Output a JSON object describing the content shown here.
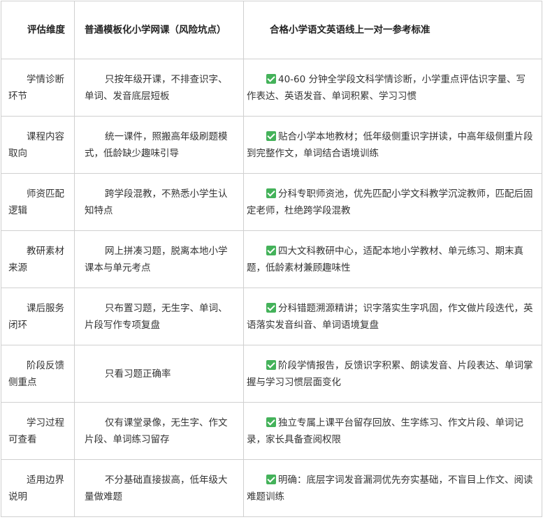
{
  "headers": {
    "dimension": "评估维度",
    "risk": "普通模板化小学网课（风险坑点）",
    "standard": "合格小学语文英语线上一对一参考标准"
  },
  "check_icon_color": "#44b25a",
  "rows": [
    {
      "dimension": "学情诊断环节",
      "risk": "只按年级开课，不排查识字、单词、发音底层短板",
      "standard": "40-60 分钟全学段文科学情诊断，小学重点评估识字量、写作表达、英语发音、单词积累、学习习惯"
    },
    {
      "dimension": "课程内容取向",
      "risk": "统一课件，照搬高年级刷题模式，低龄缺少趣味引导",
      "standard": "贴合小学本地教材；低年级侧重识字拼读，中高年级侧重片段到完整作文，单词结合语境训练"
    },
    {
      "dimension": "师资匹配逻辑",
      "risk": "跨学段混教，不熟悉小学生认知特点",
      "standard": "分科专职师资池，优先匹配小学文科教学沉淀教师，匹配后固定老师，杜绝跨学段混教"
    },
    {
      "dimension": "教研素材来源",
      "risk": "网上拼凑习题，脱离本地小学课本与单元考点",
      "standard": "四大文科教研中心，适配本地小学教材、单元练习、期末真题，低龄素材兼顾趣味性"
    },
    {
      "dimension": "课后服务闭环",
      "risk": "只布置习题，无生字、单词、片段写作专项复盘",
      "standard": "分科错题溯源精讲；识字落实生字巩固，作文做片段迭代，英语落实发音纠音、单词语境复盘"
    },
    {
      "dimension": "阶段反馈侧重点",
      "risk": "只看习题正确率",
      "standard": "阶段学情报告，反馈识字积累、朗读发音、片段表达、单词掌握与学习习惯层面变化"
    },
    {
      "dimension": "学习过程可查看",
      "risk": "仅有课堂录像，无生字、作文片段、单词练习留存",
      "standard": "独立专属上课平台留存回放、生字练习、作文片段、单词记录，家长具备查阅权限"
    },
    {
      "dimension": "适用边界说明",
      "risk": "不分基础直接拔高，低年级大量做难题",
      "standard": "明确：底层字词发音漏洞优先夯实基础，不盲目上作文、阅读难题训练"
    }
  ]
}
